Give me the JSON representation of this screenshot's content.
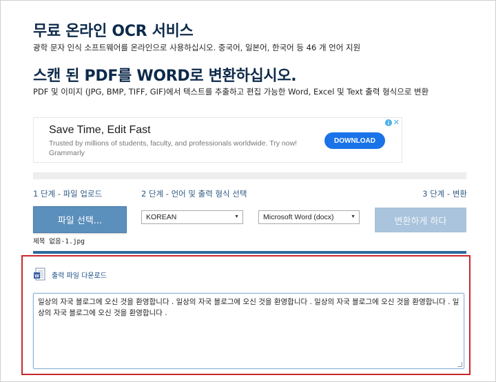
{
  "header": {
    "title": "무료 온라인 OCR 서비스",
    "subtitle": "광학 문자 인식 소프트웨어를 온라인으로 사용하십시오. 중국어, 일본어, 한국어 등 46 개 언어 지원",
    "title2": "스캔 된 PDF를 WORD로 변환하십시오.",
    "subtitle2": "PDF 및 이미지 (JPG, BMP, TIFF, GIF)에서 텍스트를 추출하고 편집 가능한 Word, Excel 및 Text 출력 형식으로 변환"
  },
  "ad": {
    "headline": "Save Time, Edit Fast",
    "description": "Trusted by millions of students, faculty, and professionals worldwide. Try now!",
    "brand": "Grammarly",
    "cta": "DOWNLOAD",
    "info_glyph": "i",
    "close_glyph": "✕"
  },
  "steps": {
    "step1": "1 단계 - 파일 업로드",
    "step2": "2 단계 - 언어 및 출력 형식 선택",
    "step3": "3 단계 - 변환"
  },
  "controls": {
    "choose_file": "파일 선택...",
    "language_selected": "KOREAN",
    "format_selected": "Microsoft Word (docx)",
    "convert": "변환하게 하다",
    "filename": "제목 없음-1.jpg"
  },
  "output": {
    "download_link": "출력 파일 다운로드",
    "text": "일상의 자국 블로그에 오신 것을 환영합니다 .  일상의 자국 블로그에 오신 것을 환영합니다 .  일상의 자국 블로그에 오신 것을 환영합니다 .  일상의 자국 블로그에 오신 것을 환영합니다 ."
  },
  "colors": {
    "title": "#0d2a4a",
    "step": "#2f5a85",
    "button": "#5b8fbc",
    "convert_disabled": "#a9c4dc",
    "highlight": "#c8262b",
    "ad_button": "#1a73e8"
  }
}
